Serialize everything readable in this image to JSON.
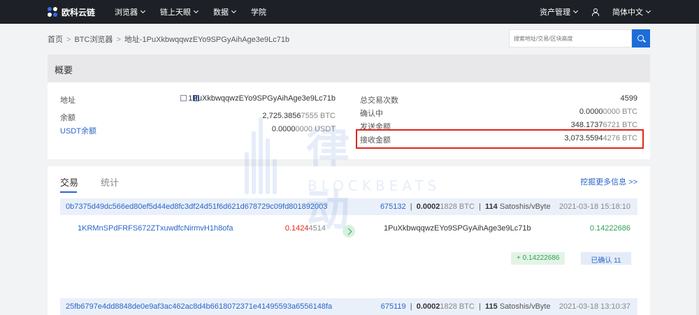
{
  "brand": "欧科云链",
  "nav": {
    "items": [
      "浏览器",
      "链上天眼",
      "数据",
      "学院"
    ],
    "right": {
      "asset_mgmt": "资产管理",
      "language": "简体中文"
    }
  },
  "breadcrumb": {
    "home": "首页",
    "browser": "BTC浏览器",
    "current": "地址-1PuXkbwqqwzEYo9SPGyAihAge3e9Lc71b"
  },
  "search": {
    "placeholder": "搜索地址/交易/区块高度"
  },
  "overview": {
    "title": "概要",
    "left": {
      "address_label": "地址",
      "address": "1PuXkbwqqwzEYo9SPGyAihAge3e9Lc71b",
      "balance_label": "余额",
      "balance_main": "2,725.3856",
      "balance_tail": "7555 BTC",
      "usdt_label": "USDT余额",
      "usdt_main": "0.0000",
      "usdt_tail": "0000 USDT"
    },
    "right": {
      "tx_count_label": "总交易次数",
      "tx_count": "4599",
      "confirming_label": "确认中",
      "confirming_main": "0.0000",
      "confirming_tail": "0000 BTC",
      "sent_label": "发送金额",
      "sent_main": "348.1737",
      "sent_tail": "6721 BTC",
      "received_label": "接收金额",
      "received_main": "3,073.5594",
      "received_tail": "4276 BTC"
    }
  },
  "transactions": {
    "tab_tx": "交易",
    "tab_stats": "统计",
    "more_link": "挖掘更多信息 >>",
    "items": [
      {
        "hash": "0b7375d49dc566ed80ef5d44ed8fc3df24d51f6d621d678729c09fd801892003",
        "block": "675132",
        "fee_main": "0.0002",
        "fee_tail": "1828 BTC",
        "rate_num": "114",
        "rate_unit": "Satoshis/vByte",
        "time": "2021-03-18 15:18:10",
        "from": "1KRMnSPdFRFS672ZTxuwdfcNirmvH1h8ofa",
        "from_amt_main": "0.1424",
        "from_amt_tail": "4514",
        "to": "1PuXkbwqqwzEYo9SPGyAihAge3e9Lc71b",
        "to_amt": "0.14222686",
        "net": "+ 0.14222686",
        "confirmed": "已确认 11"
      },
      {
        "hash": "25fb6797e4dd8848de0e9af3ac462ac8d4b6618072371e41495593a6556148fa",
        "block": "675119",
        "fee_main": "0.0002",
        "fee_tail": "1828 BTC",
        "rate_num": "115",
        "rate_unit": "Satoshis/vByte",
        "time": "2021-03-18 13:10:37"
      }
    ]
  },
  "watermark": {
    "text": "律动",
    "sub": "BLOCKBEATS"
  }
}
